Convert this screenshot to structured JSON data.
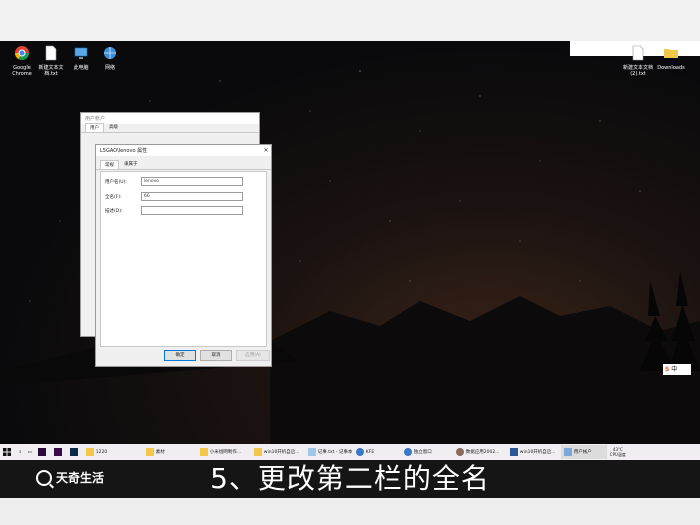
{
  "desktop": {
    "icons": [
      {
        "label": "Google Chrome",
        "icon": "chrome-icon"
      },
      {
        "label": "新建文本文档.txt",
        "icon": "text-file-icon"
      },
      {
        "label": "此电脑",
        "icon": "computer-icon"
      },
      {
        "label": "网络",
        "icon": "network-icon"
      }
    ],
    "right_icons": [
      {
        "label": "新建文本文档 (2).txt",
        "icon": "text-file-icon"
      },
      {
        "label": "Downloads",
        "icon": "folder-icon"
      }
    ]
  },
  "user_accounts_window": {
    "title": "用户帐户",
    "tabs": [
      "用户",
      "高级"
    ],
    "active_tab": "用户"
  },
  "properties_dialog": {
    "title": "L5GAO\\lenovo 属性",
    "tabs": [
      "常规",
      "隶属于"
    ],
    "active_tab": "常规",
    "fields": [
      {
        "label": "用户名(U):",
        "value": "lenovo"
      },
      {
        "label": "全名(F):",
        "value": "66"
      },
      {
        "label": "描述(D):",
        "value": ""
      }
    ],
    "buttons": {
      "ok": "确定",
      "cancel": "取消",
      "apply": "应用(A)"
    }
  },
  "taskbar": {
    "items": [
      {
        "label": "1220",
        "icon": "folder-icon"
      },
      {
        "label": "素材",
        "icon": "folder-icon"
      },
      {
        "label": "小米组网制作...",
        "icon": "folder-icon"
      },
      {
        "label": "win10开机自启...",
        "icon": "folder-icon"
      },
      {
        "label": "记事.txt - 记事本",
        "icon": "notepad-icon"
      },
      {
        "label": "KFE",
        "icon": "app-icon"
      },
      {
        "label": "独立窗口",
        "icon": "app-icon"
      },
      {
        "label": "数据应用2002...",
        "icon": "app-icon"
      },
      {
        "label": "win10开机自启...",
        "icon": "word-icon"
      },
      {
        "label": "用户帐户",
        "icon": "user-accounts-icon"
      }
    ],
    "tray": {
      "temperature": "43°C",
      "cpu": "CPU温度"
    }
  },
  "ime": {
    "label": "中"
  },
  "caption": "5、更改第二栏的全名",
  "brand": "天奇生活",
  "colors": {
    "accent": "#0078d7",
    "caption_bg": "#151515"
  }
}
